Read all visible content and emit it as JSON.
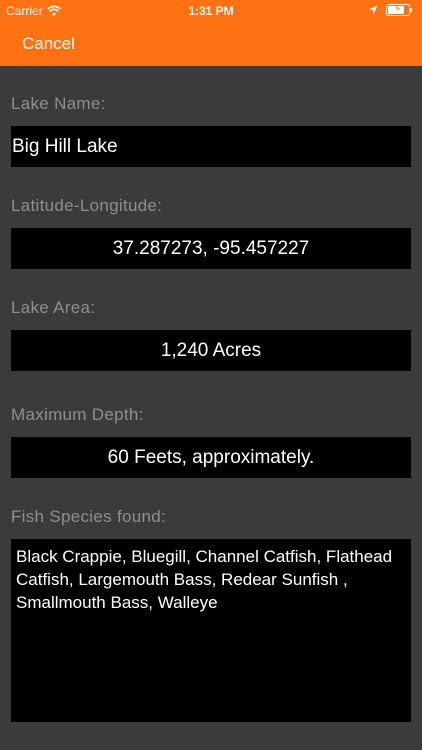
{
  "status_bar": {
    "carrier": "Carrier",
    "time": "1:31 PM",
    "icons": [
      "wifi-icon",
      "location-arrow-icon",
      "battery-charging-icon"
    ]
  },
  "nav": {
    "cancel_label": "Cancel",
    "accent_color": "#ff7214"
  },
  "form": {
    "lake_name_label": "Lake Name:",
    "lake_name_value": "Big Hill Lake",
    "latlng_label": "Latitude-Longitude:",
    "latlng_value": "37.287273, -95.457227",
    "area_label": "Lake Area:",
    "area_value": "1,240 Acres",
    "depth_label": "Maximum Depth:",
    "depth_value": "60 Feets, approximately.",
    "species_label": "Fish Species found:",
    "species_value": "Black Crappie, Bluegill, Channel Catfish, Flathead Catfish, Largemouth Bass, Redear Sunfish , Smallmouth Bass, Walleye"
  },
  "colors": {
    "background": "#3b3b3b",
    "label_text": "#8e8e8e",
    "field_bg": "#000000",
    "field_text": "#ffffff"
  }
}
